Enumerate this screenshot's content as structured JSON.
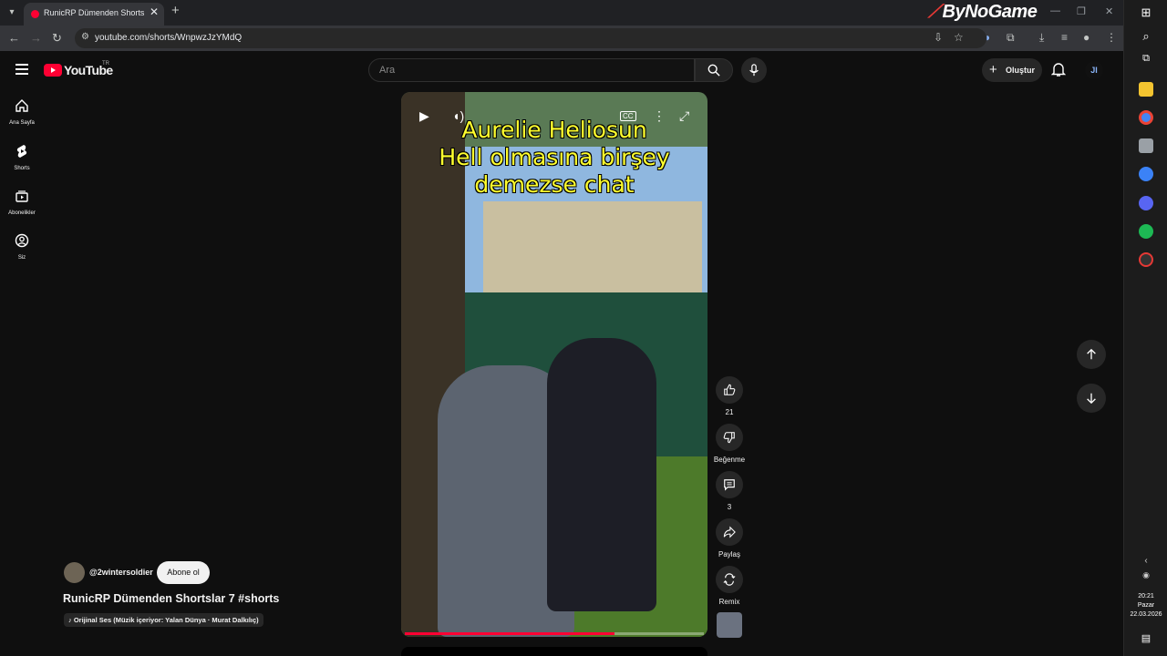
{
  "browser": {
    "tab_title": "RunicRP Dümenden Shortslar 7 #shorts - YouTube",
    "tab_close": "✕",
    "new_tab": "+",
    "url": "youtube.com/shorts/WnpwzJzYMdQ",
    "overlay_brand": "ByNoGame"
  },
  "youtube": {
    "logo_text": "YouTube",
    "logo_country": "TR",
    "search_placeholder": "Ara",
    "create_label": "Oluştur",
    "avatar_initials": "JI",
    "sidebar": [
      {
        "label": "Ana Sayfa",
        "icon": "home-icon"
      },
      {
        "label": "Shorts",
        "icon": "shorts-icon"
      },
      {
        "label": "Abonelikler",
        "icon": "subscriptions-icon"
      },
      {
        "label": "Siz",
        "icon": "you-icon"
      }
    ]
  },
  "video": {
    "caption_line1": "Aurelie Heliosun",
    "caption_line2": "Hell olmasına birşey",
    "caption_line3": "demezse chat",
    "progress": 0.7
  },
  "actions": {
    "like_count": "21",
    "dislike_label": "Beğenme",
    "comment_count": "3",
    "share_label": "Paylaş",
    "remix_label": "Remix"
  },
  "channel": {
    "handle": "@2wintersoldier",
    "subscribe_label": "Abone ol",
    "short_title": "RunicRP Dümenden Shortslar 7 #shorts",
    "music": "Orijinal Ses (Müzik içeriyor: Yalan Dünya · Murat Dalkılıç)"
  },
  "taskbar": {
    "time": "20:21",
    "day": "Pazar",
    "date": "22.03.2026"
  },
  "colors": {
    "brand_red": "#ff0033",
    "caption_yellow": "#ffff2e",
    "background": "#0f0f0f"
  }
}
